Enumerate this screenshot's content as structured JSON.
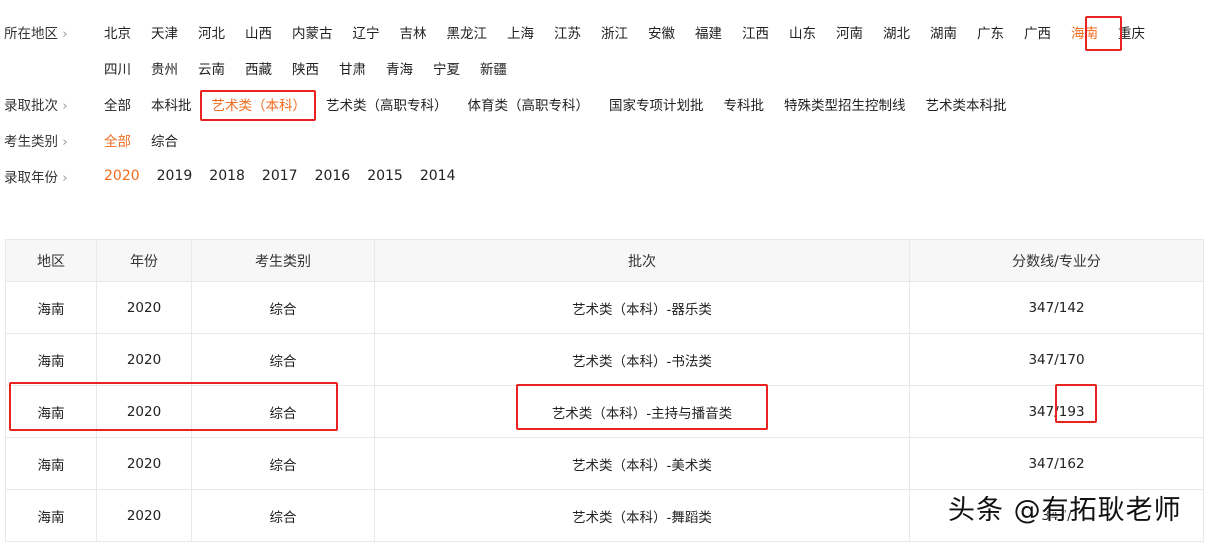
{
  "filters": {
    "region": {
      "label": "所在地区",
      "items": [
        "北京",
        "天津",
        "河北",
        "山西",
        "内蒙古",
        "辽宁",
        "吉林",
        "黑龙江",
        "上海",
        "江苏",
        "浙江",
        "安徽",
        "福建",
        "江西",
        "山东",
        "河南",
        "湖北",
        "湖南",
        "广东",
        "广西",
        "海南",
        "重庆"
      ],
      "items2": [
        "四川",
        "贵州",
        "云南",
        "西藏",
        "陕西",
        "甘肃",
        "青海",
        "宁夏",
        "新疆"
      ],
      "selected": "海南"
    },
    "batch": {
      "label": "录取批次",
      "items": [
        "全部",
        "本科批",
        "艺术类（本科）",
        "艺术类（高职专科）",
        "体育类（高职专科）",
        "国家专项计划批",
        "专科批",
        "特殊类型招生控制线",
        "艺术类本科批"
      ],
      "selected": "艺术类（本科）"
    },
    "type": {
      "label": "考生类别",
      "items": [
        "全部",
        "综合"
      ],
      "selected": "全部"
    },
    "year": {
      "label": "录取年份",
      "items": [
        "2020",
        "2019",
        "2018",
        "2017",
        "2016",
        "2015",
        "2014"
      ],
      "selected": "2020"
    }
  },
  "table": {
    "headers": [
      "地区",
      "年份",
      "考生类别",
      "批次",
      "分数线/专业分"
    ],
    "rows": [
      [
        "海南",
        "2020",
        "综合",
        "艺术类（本科）-器乐类",
        "347/142"
      ],
      [
        "海南",
        "2020",
        "综合",
        "艺术类（本科）-书法类",
        "347/170"
      ],
      [
        "海南",
        "2020",
        "综合",
        "艺术类（本科）-主持与播音类",
        "347/193"
      ],
      [
        "海南",
        "2020",
        "综合",
        "艺术类（本科）-美术类",
        "347/162"
      ],
      [
        "海南",
        "2020",
        "综合",
        "艺术类（本科）-舞蹈类",
        "347/"
      ]
    ]
  },
  "watermark": "头条 @有拓耿老师",
  "accent": "#f26b1d",
  "highlight": "#e8231f"
}
